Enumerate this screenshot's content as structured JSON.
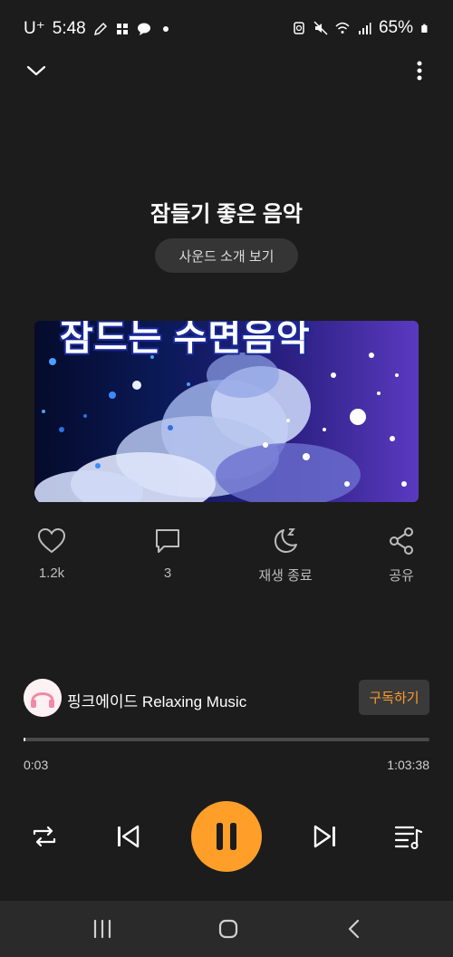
{
  "status_bar": {
    "carrier": "U⁺",
    "time": "5:48",
    "battery": "65%"
  },
  "header": {
    "title": "잠들기 좋은 음악",
    "intro_button": "사운드 소개 보기"
  },
  "artwork": {
    "overlay_text": "잠드는 수면음악"
  },
  "actions": [
    {
      "name": "like",
      "label": "1.2k"
    },
    {
      "name": "comments",
      "label": "3"
    },
    {
      "name": "sleep-timer",
      "label": "재생 종료"
    },
    {
      "name": "share",
      "label": "공유"
    }
  ],
  "channel": {
    "name": "핑크에이드 Relaxing Music",
    "subscribe_label": "구독하기"
  },
  "progress": {
    "current": "0:03",
    "total": "1:03:38",
    "fraction": 0.0008
  },
  "colors": {
    "accent": "#ff9f2a",
    "background": "#1c1c1c"
  }
}
